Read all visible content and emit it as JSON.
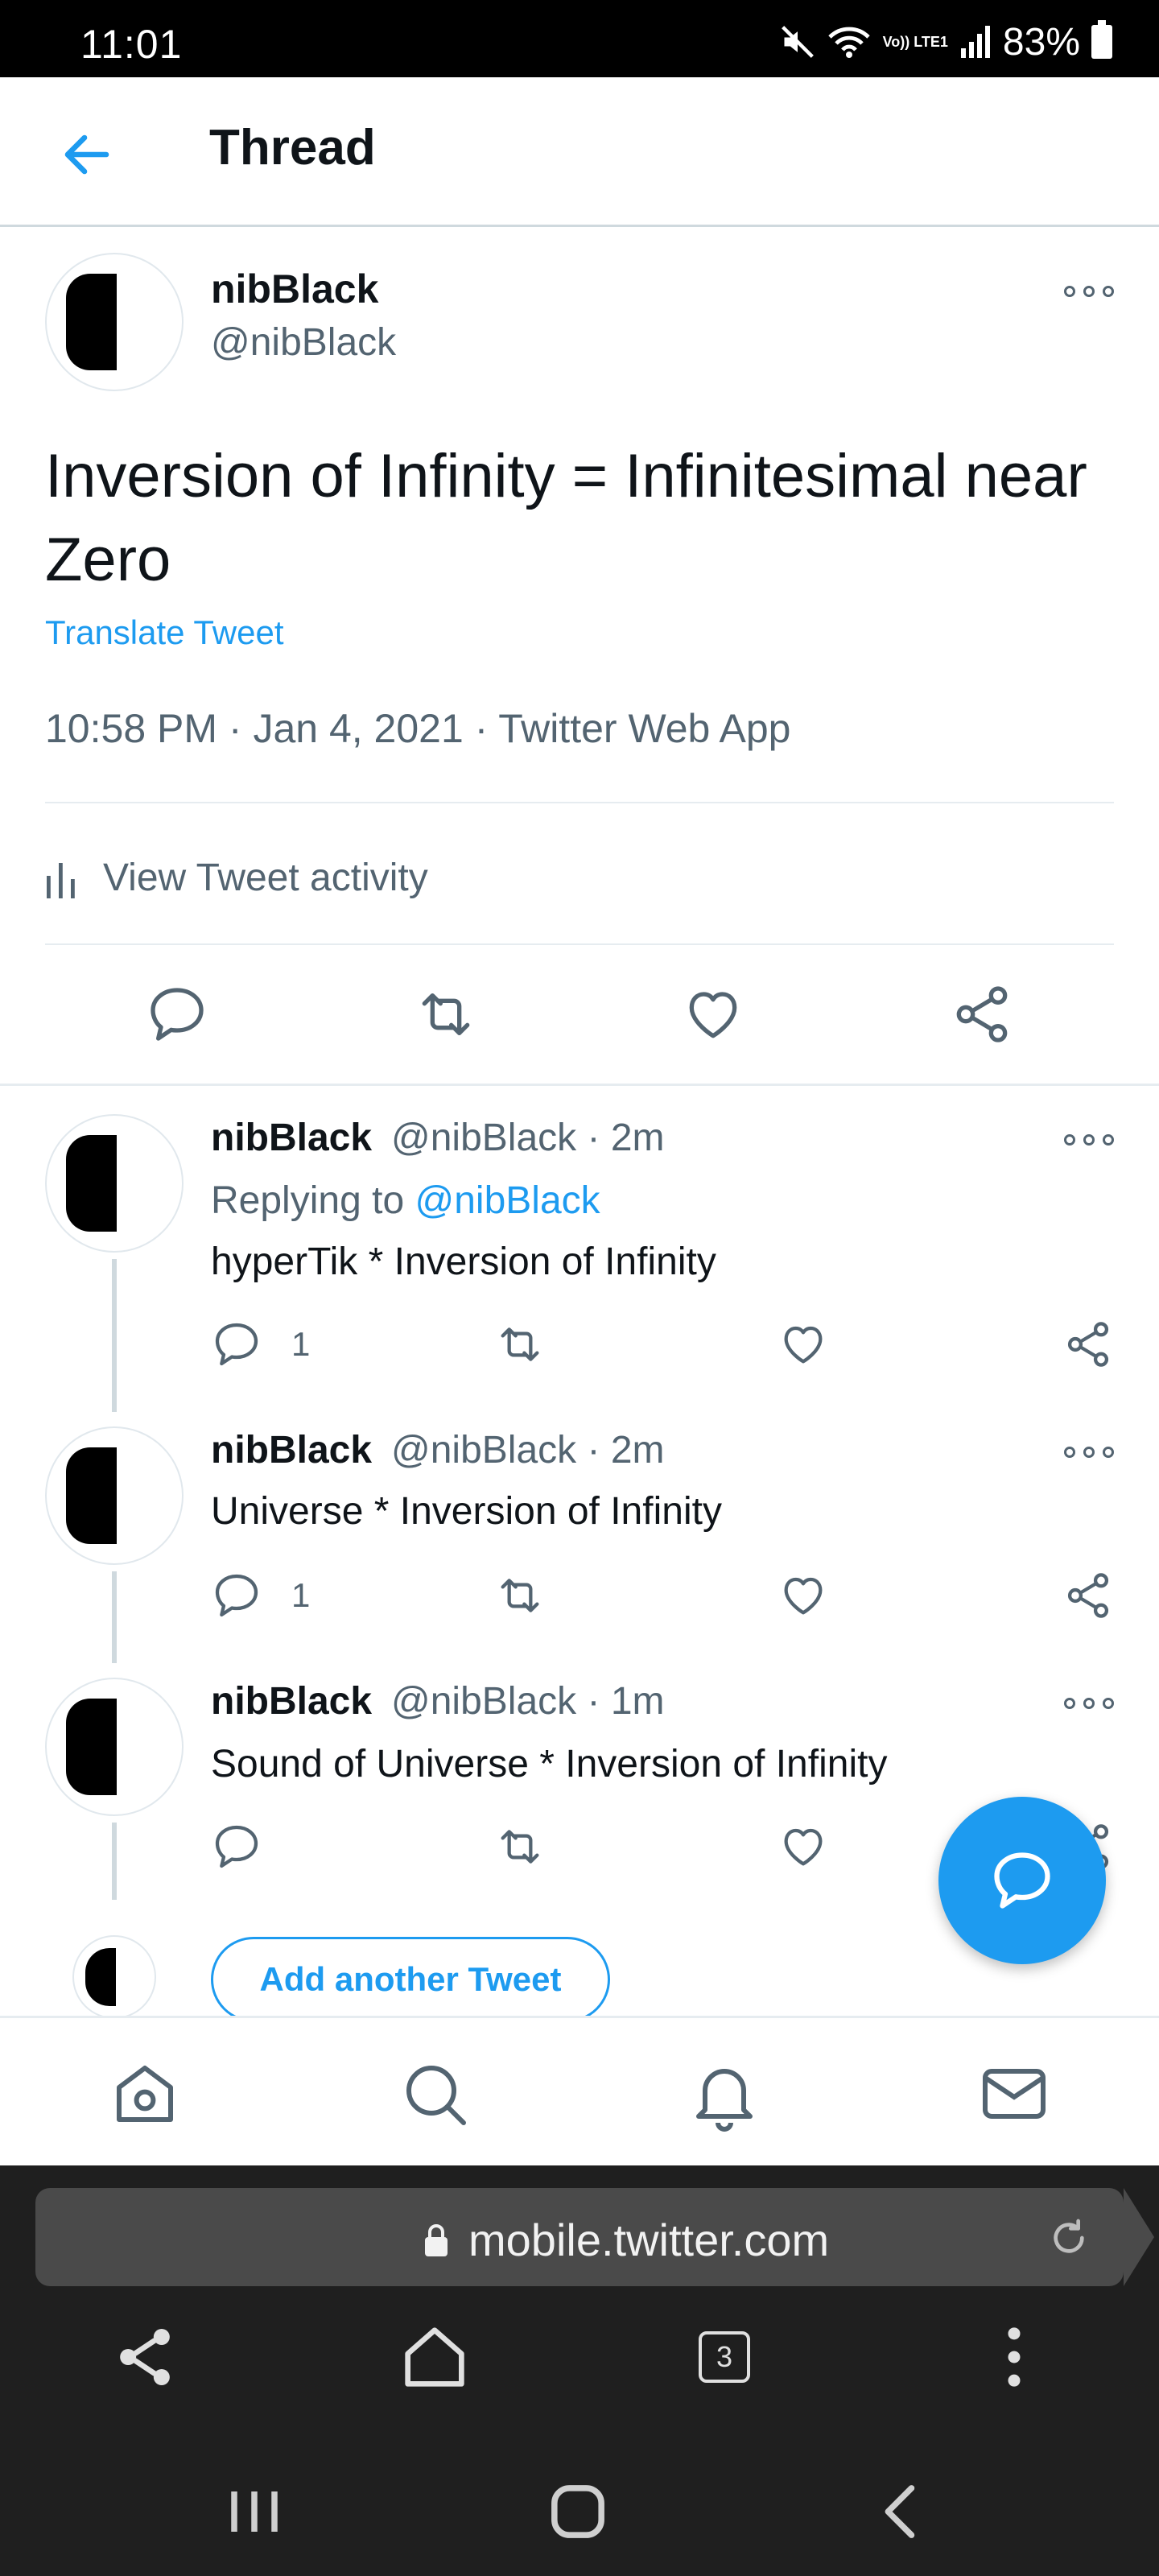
{
  "status_bar": {
    "time": "11:01",
    "network": "Vo)) LTE1",
    "battery": "83%"
  },
  "header": {
    "title": "Thread"
  },
  "main_tweet": {
    "name": "nibBlack",
    "handle": "@nibBlack",
    "text": "Inversion of Infinity = Infinitesimal near Zero",
    "translate_label": "Translate Tweet",
    "meta": "10:58 PM · Jan 4, 2021 · Twitter Web App",
    "activity_label": "View Tweet activity"
  },
  "replies": [
    {
      "name": "nibBlack",
      "handle": "@nibBlack · 2m",
      "replying_prefix": "Replying to ",
      "replying_to": "@nibBlack",
      "text": "hyperTik * Inversion of Infinity",
      "reply_count": "1"
    },
    {
      "name": "nibBlack",
      "handle": "@nibBlack · 2m",
      "text": "Universe * Inversion of Infinity",
      "reply_count": "1"
    },
    {
      "name": "nibBlack",
      "handle": "@nibBlack · 1m",
      "text": "Sound of Universe * Inversion of Infinity",
      "reply_count": ""
    }
  ],
  "add_tweet_label": "Add another Tweet",
  "browser": {
    "url": "mobile.twitter.com",
    "tab_count": "3"
  },
  "colors": {
    "accent": "#1d9bf0",
    "secondary_text": "#536471",
    "primary_text": "#0f1419"
  }
}
